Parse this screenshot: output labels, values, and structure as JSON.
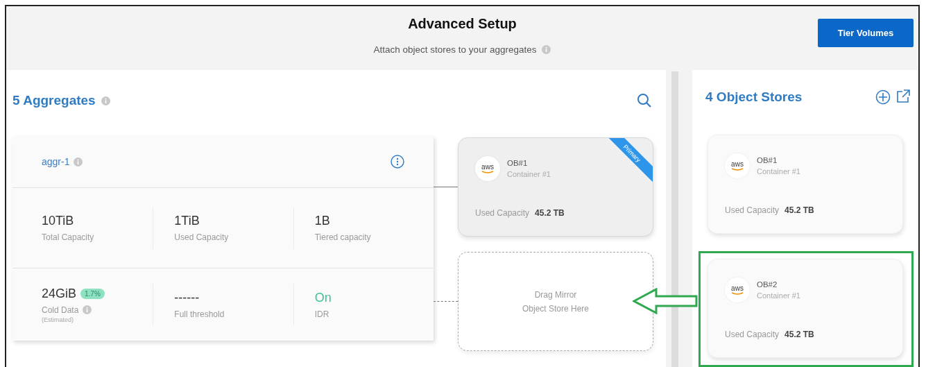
{
  "header": {
    "title": "Advanced Setup",
    "subtitle": "Attach object stores to your aggregates",
    "button": "Tier Volumes"
  },
  "aggregates": {
    "count": "5",
    "title": "Aggregates",
    "card": {
      "name": "aggr-1",
      "stats": [
        [
          {
            "kind": "plain",
            "value": "10TiB",
            "label": "Total Capacity"
          },
          {
            "kind": "plain",
            "value": "1TiB",
            "label": "Used Capacity"
          },
          {
            "kind": "plain",
            "value": "1B",
            "label": "Tiered capacity"
          }
        ],
        [
          {
            "kind": "plain",
            "value": "24GiB",
            "badge": "1.7%",
            "label": "Cold Data",
            "info": true,
            "note": "(Estimated)"
          },
          {
            "kind": "plain",
            "value": "------",
            "label": "Full threshold"
          },
          {
            "kind": "status",
            "value": "On",
            "label": "IDR"
          }
        ]
      ]
    },
    "attached": [
      {
        "kind": "store",
        "dashed_link": false,
        "logo": "aws",
        "name": "OB#1",
        "container": "Container #1",
        "capacity_label": "Used Capacity",
        "capacity": "45.2 TB",
        "ribbon": "Primary"
      },
      {
        "kind": "dropzone",
        "dashed_link": true,
        "lines": [
          "Drag Mirror",
          "Object Store Here"
        ]
      }
    ]
  },
  "object_stores": {
    "count": "4",
    "title": "Object Stores",
    "items": [
      {
        "logo": "aws",
        "name": "OB#1",
        "container": "Container #1",
        "capacity_label": "Used Capacity",
        "capacity": "45.2 TB",
        "highlighted": false
      },
      {
        "logo": "aws",
        "name": "OB#2",
        "container": "Container #1",
        "capacity_label": "Used Capacity",
        "capacity": "45.2 TB",
        "highlighted": true
      }
    ]
  }
}
